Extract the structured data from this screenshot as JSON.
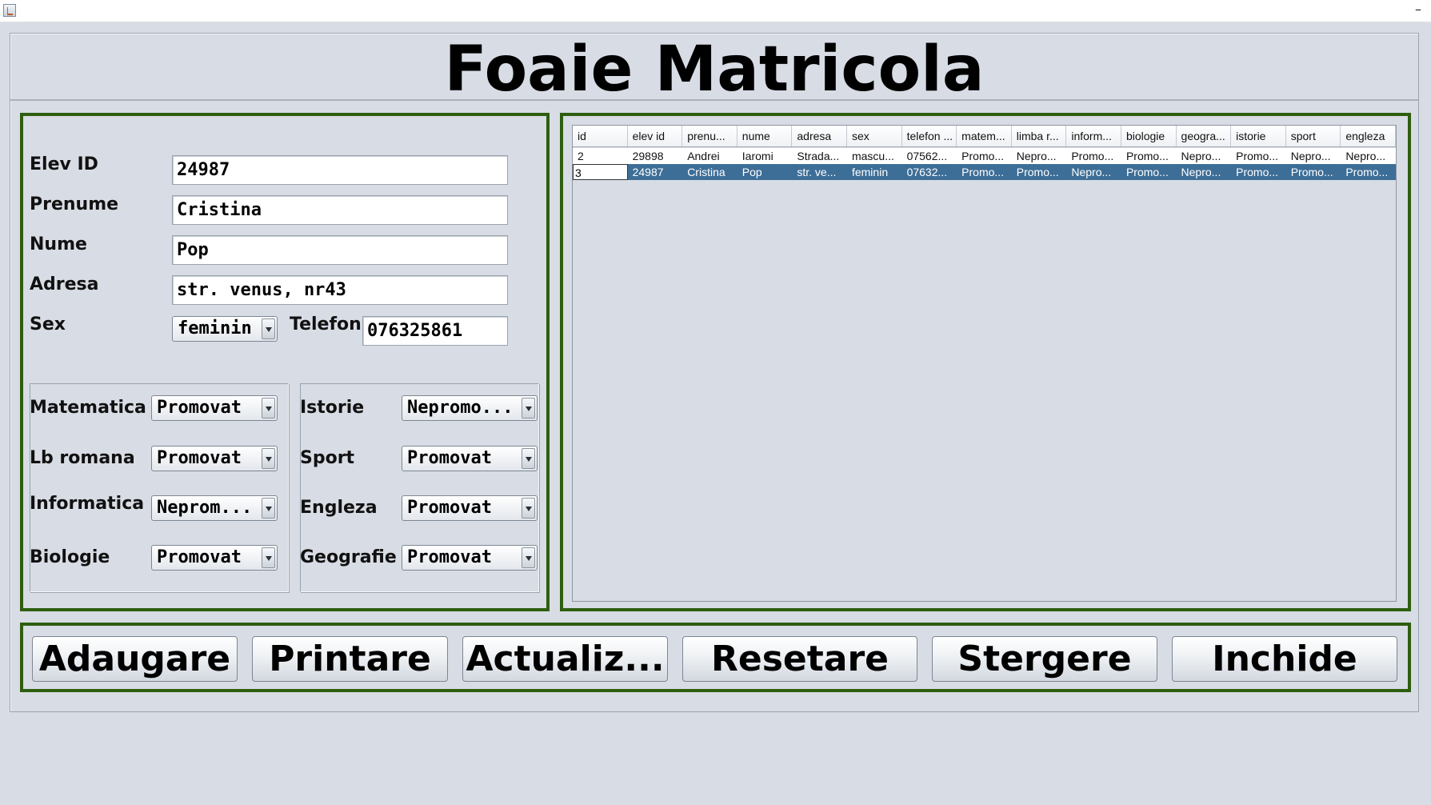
{
  "page_title": "Foaie Matricola",
  "form": {
    "elev_id": {
      "label": "Elev ID",
      "value": "24987"
    },
    "prenume": {
      "label": "Prenume",
      "value": "Cristina"
    },
    "nume": {
      "label": "Nume",
      "value": "Pop"
    },
    "adresa": {
      "label": "Adresa",
      "value": "str. venus, nr43"
    },
    "sex": {
      "label": "Sex",
      "value": "feminin"
    },
    "telefon": {
      "label": "Telefon",
      "value": "076325861"
    }
  },
  "grades": {
    "matematica": {
      "label": "Matematica",
      "value": "Promovat"
    },
    "lb_romana": {
      "label": "Lb romana",
      "value": "Promovat"
    },
    "informatica": {
      "label": "Informatica",
      "value": "Neprom..."
    },
    "biologie": {
      "label": "Biologie",
      "value": "Promovat"
    },
    "istorie": {
      "label": "Istorie",
      "value": "Nepromo..."
    },
    "sport": {
      "label": "Sport",
      "value": "Promovat"
    },
    "engleza": {
      "label": "Engleza",
      "value": "Promovat"
    },
    "geografie": {
      "label": "Geografie",
      "value": "Promovat"
    }
  },
  "table": {
    "columns": [
      "id",
      "elev id",
      "prenu...",
      "nume",
      "adresa",
      "sex",
      "telefon ...",
      "matem...",
      "limba r...",
      "inform...",
      "biologie",
      "geogra...",
      "istorie",
      "sport",
      "engleza"
    ],
    "rows": [
      [
        "2",
        "29898",
        "Andrei",
        "Iaromi",
        "Strada...",
        "mascu...",
        "07562...",
        "Promo...",
        "Nepro...",
        "Promo...",
        "Promo...",
        "Nepro...",
        "Promo...",
        "Nepro...",
        "Nepro..."
      ],
      [
        "3",
        "24987",
        "Cristina",
        "Pop",
        "str. ve...",
        "feminin",
        "07632...",
        "Promo...",
        "Promo...",
        "Nepro...",
        "Promo...",
        "Nepro...",
        "Promo...",
        "Promo...",
        "Promo..."
      ]
    ]
  },
  "buttons": {
    "adaugare": "Adaugare",
    "printare": "Printare",
    "actualizare": "Actualiz...",
    "resetare": "Resetare",
    "stergere": "Stergere",
    "inchide": "Inchide"
  },
  "window": {
    "minimize": "–"
  },
  "colors": {
    "panel_border": "#2e5e10",
    "selection": "#3d6e97",
    "background": "#d8dce4"
  }
}
